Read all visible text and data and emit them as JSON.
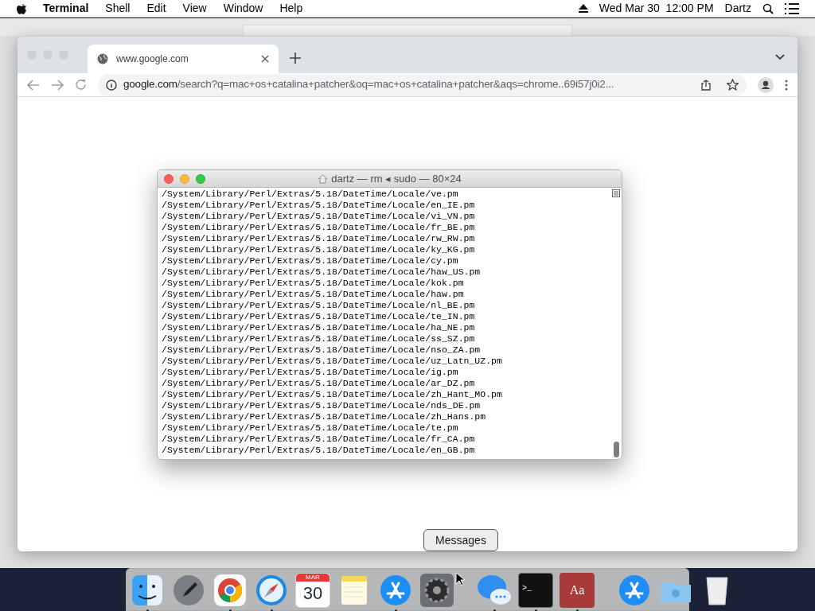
{
  "menu_bar": {
    "app": "Terminal",
    "menus": [
      "Shell",
      "Edit",
      "View",
      "Window",
      "Help"
    ],
    "clock": "Wed Mar 30  12:00 PM",
    "user": "Dartz"
  },
  "browser": {
    "tabs": [
      {
        "title": "www.google.com",
        "selected": true
      }
    ],
    "address": {
      "host": "google.com",
      "path": "/search?q=mac+os+catalina+patcher&oq=mac+os+catalina+patcher&aqs=chrome..69i57j0i2..."
    }
  },
  "terminal": {
    "title": "dartz — rm ◂ sudo — 80×24",
    "lines": [
      "/System/Library/Perl/Extras/5.18/DateTime/Locale/ve.pm",
      "/System/Library/Perl/Extras/5.18/DateTime/Locale/en_IE.pm",
      "/System/Library/Perl/Extras/5.18/DateTime/Locale/vi_VN.pm",
      "/System/Library/Perl/Extras/5.18/DateTime/Locale/fr_BE.pm",
      "/System/Library/Perl/Extras/5.18/DateTime/Locale/rw_RW.pm",
      "/System/Library/Perl/Extras/5.18/DateTime/Locale/ky_KG.pm",
      "/System/Library/Perl/Extras/5.18/DateTime/Locale/cy.pm",
      "/System/Library/Perl/Extras/5.18/DateTime/Locale/haw_US.pm",
      "/System/Library/Perl/Extras/5.18/DateTime/Locale/kok.pm",
      "/System/Library/Perl/Extras/5.18/DateTime/Locale/haw.pm",
      "/System/Library/Perl/Extras/5.18/DateTime/Locale/nl_BE.pm",
      "/System/Library/Perl/Extras/5.18/DateTime/Locale/te_IN.pm",
      "/System/Library/Perl/Extras/5.18/DateTime/Locale/ha_NE.pm",
      "/System/Library/Perl/Extras/5.18/DateTime/Locale/ss_SZ.pm",
      "/System/Library/Perl/Extras/5.18/DateTime/Locale/nso_ZA.pm",
      "/System/Library/Perl/Extras/5.18/DateTime/Locale/uz_Latn_UZ.pm",
      "/System/Library/Perl/Extras/5.18/DateTime/Locale/ig.pm",
      "/System/Library/Perl/Extras/5.18/DateTime/Locale/ar_DZ.pm",
      "/System/Library/Perl/Extras/5.18/DateTime/Locale/zh_Hant_MO.pm",
      "/System/Library/Perl/Extras/5.18/DateTime/Locale/nds_DE.pm",
      "/System/Library/Perl/Extras/5.18/DateTime/Locale/zh_Hans.pm",
      "/System/Library/Perl/Extras/5.18/DateTime/Locale/te.pm",
      "/System/Library/Perl/Extras/5.18/DateTime/Locale/fr_CA.pm",
      "/System/Library/Perl/Extras/5.18/DateTime/Locale/en_GB.pm"
    ]
  },
  "tooltip": "Messages",
  "dock": [
    {
      "kind": "finder",
      "running": true
    },
    {
      "kind": "launchpad",
      "running": false
    },
    {
      "kind": "chrome",
      "running": true
    },
    {
      "kind": "safari",
      "running": true
    },
    {
      "kind": "calendar",
      "running": false,
      "month": "MAR",
      "day": "30"
    },
    {
      "kind": "notes",
      "running": false
    },
    {
      "kind": "appstore",
      "running": true
    },
    {
      "kind": "settings",
      "running": false
    },
    {
      "kind": "divider"
    },
    {
      "kind": "messages",
      "running": true
    },
    {
      "kind": "terminal",
      "running": true,
      "prompt": ">_"
    },
    {
      "kind": "dictionary",
      "running": true,
      "glyph": "Aa"
    },
    {
      "kind": "divider"
    },
    {
      "kind": "appstore",
      "running": false
    },
    {
      "kind": "folder",
      "running": false
    },
    {
      "kind": "trash",
      "running": false
    }
  ]
}
